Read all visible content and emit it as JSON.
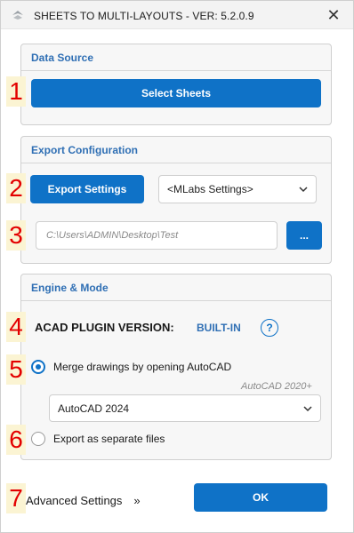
{
  "window": {
    "title": "SHEETS TO MULTI-LAYOUTS - VER: 5.2.0.9",
    "close_glyph": "✕"
  },
  "step_numbers": [
    "1",
    "2",
    "3",
    "4",
    "5",
    "6",
    "7"
  ],
  "data_source": {
    "heading": "Data Source",
    "select_sheets_label": "Select Sheets"
  },
  "export_config": {
    "heading": "Export Configuration",
    "export_settings_label": "Export Settings",
    "settings_dropdown_value": "<MLabs Settings>",
    "path_value": "C:\\Users\\ADMIN\\Desktop\\Test",
    "browse_label": "..."
  },
  "engine_mode": {
    "heading": "Engine & Mode",
    "plugin_version_label": "ACAD PLUGIN VERSION:",
    "plugin_version_value": "BUILT-IN",
    "help_glyph": "?",
    "merge_label": "Merge drawings by opening AutoCAD",
    "autocad_hint": "AutoCAD 2020+",
    "autocad_version_value": "AutoCAD 2024",
    "separate_label": "Export as separate files",
    "merge_selected": true
  },
  "footer": {
    "advanced_label": "Advanced Settings",
    "advanced_chevron": "»",
    "ok_label": "OK"
  },
  "colors": {
    "accent": "#0f72c7",
    "heading": "#2f6fb4",
    "step": "#e30000"
  }
}
